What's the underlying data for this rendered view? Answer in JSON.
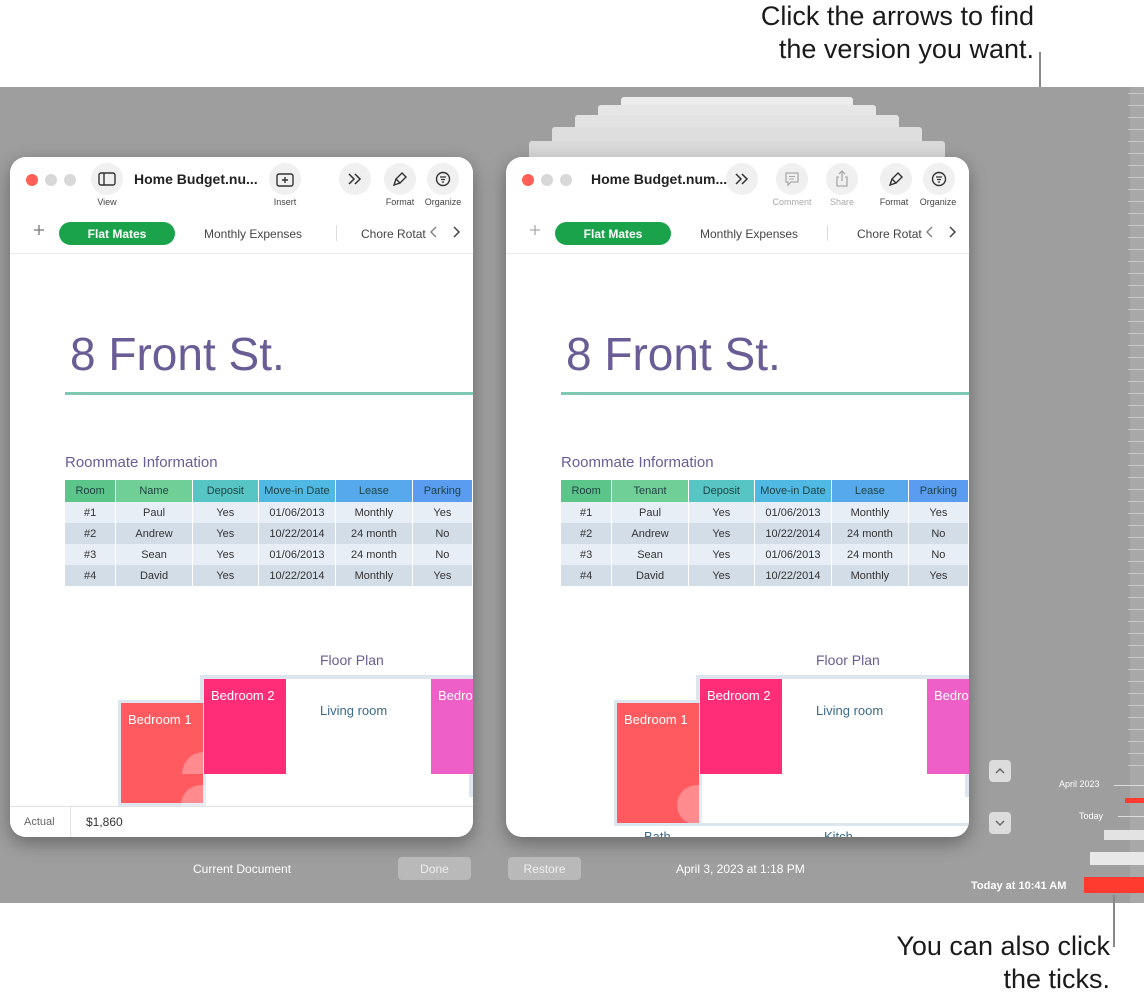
{
  "callouts": {
    "top_line1": "Click the arrows to find",
    "top_line2": "the version you want.",
    "bottom_line1": "You can also click",
    "bottom_line2": "the ticks."
  },
  "left_window": {
    "doc_title": "Home Budget.nu...",
    "toolbar": {
      "view": "View",
      "insert": "Insert",
      "format": "Format",
      "organize": "Organize"
    },
    "tabs": {
      "active": "Flat Mates",
      "second": "Monthly Expenses",
      "third": "Chore Rotat"
    },
    "sheet_title": "8 Front St.",
    "section_title": "Roommate Information",
    "table": {
      "headers": [
        "Room",
        "Name",
        "Deposit",
        "Move-in Date",
        "Lease",
        "Parking"
      ],
      "rows": [
        [
          "#1",
          "Paul",
          "Yes",
          "01/06/2013",
          "Monthly",
          "Yes"
        ],
        [
          "#2",
          "Andrew",
          "Yes",
          "10/22/2014",
          "24 month",
          "No"
        ],
        [
          "#3",
          "Sean",
          "Yes",
          "01/06/2013",
          "24 month",
          "No"
        ],
        [
          "#4",
          "David",
          "Yes",
          "10/22/2014",
          "Monthly",
          "Yes"
        ]
      ]
    },
    "floor_plan": {
      "title": "Floor Plan",
      "bedroom1": "Bedroom 1",
      "bedroom2": "Bedroom 2",
      "bedroom3": "Bedro",
      "living_room": "Living room"
    },
    "status": {
      "label": "Actual",
      "value": "$1,860"
    }
  },
  "right_window": {
    "doc_title": "Home Budget.num...",
    "toolbar": {
      "comment": "Comment",
      "share": "Share",
      "format": "Format",
      "organize": "Organize"
    },
    "tabs": {
      "active": "Flat Mates",
      "second": "Monthly Expenses",
      "third": "Chore Rotat"
    },
    "sheet_title": "8 Front St.",
    "section_title": "Roommate Information",
    "table": {
      "headers": [
        "Room",
        "Tenant",
        "Deposit",
        "Move-in Date",
        "Lease",
        "Parking"
      ],
      "rows": [
        [
          "#1",
          "Paul",
          "Yes",
          "01/06/2013",
          "Monthly",
          "Yes"
        ],
        [
          "#2",
          "Andrew",
          "Yes",
          "10/22/2014",
          "24 month",
          "No"
        ],
        [
          "#3",
          "Sean",
          "Yes",
          "01/06/2013",
          "24 month",
          "No"
        ],
        [
          "#4",
          "David",
          "Yes",
          "10/22/2014",
          "Monthly",
          "Yes"
        ]
      ]
    },
    "floor_plan": {
      "title": "Floor Plan",
      "bedroom1": "Bedroom 1",
      "bedroom2": "Bedroom 2",
      "bedroom3": "Bedro",
      "living_room": "Living room",
      "partial1": "Bath",
      "partial2": "Kitch"
    }
  },
  "bottom_bar": {
    "current_document": "Current Document",
    "done": "Done",
    "restore": "Restore",
    "version_date": "April 3, 2023 at 1:18 PM"
  },
  "timeline": {
    "label_april": "April 2023",
    "label_today": "Today",
    "label_now": "Today at 10:41 AM"
  },
  "colors": {
    "accent_green": "#1aa34a",
    "bedroom1": "#ff5a5f",
    "bedroom2": "#ff2d78",
    "bedroom3": "#ee5fc8",
    "timeline_red": "#ff3b30",
    "title_purple": "#6a5d96"
  },
  "icons": [
    "sidebar-icon",
    "insert-icon",
    "chevrons-icon",
    "paintbrush-icon",
    "organize-icon",
    "comment-icon",
    "share-icon",
    "plus-icon",
    "chevron-left-icon",
    "chevron-right-icon",
    "chevron-up-icon",
    "chevron-down-icon"
  ]
}
